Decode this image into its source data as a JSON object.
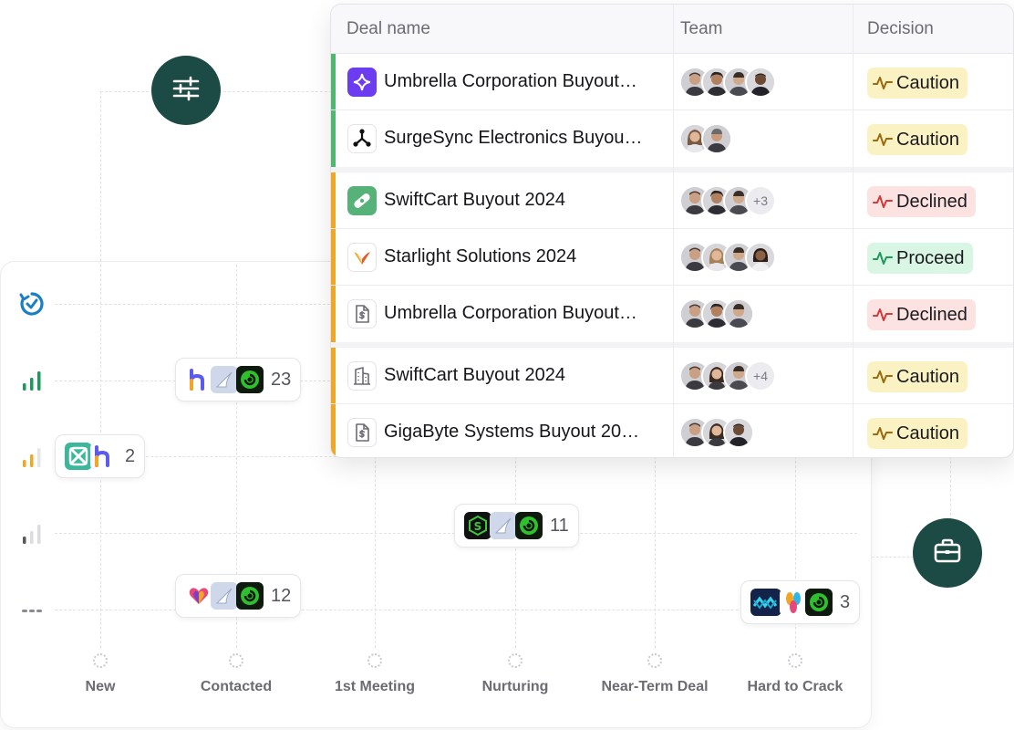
{
  "colors": {
    "accent_dark": "#1c4a44",
    "group_green": "#4cb96d",
    "group_amber": "#f2a623",
    "caution_bg": "#fbf2c4",
    "declined_bg": "#fde2e2",
    "proceed_bg": "#d9f5e3"
  },
  "table": {
    "headers": {
      "deal_name": "Deal name",
      "team": "Team",
      "decision": "Decision"
    },
    "rows": [
      {
        "name": "Umbrella Corporation Buyout…",
        "icon": "sparkle-logo-icon",
        "extra": "",
        "decision": "Caution"
      },
      {
        "name": "SurgeSync Electronics Buyou…",
        "icon": "network-logo-icon",
        "extra": "",
        "decision": "Caution"
      },
      {
        "name": "SwiftCart Buyout 2024",
        "icon": "bandage-logo-icon",
        "extra": "+3",
        "decision": "Declined"
      },
      {
        "name": "Starlight Solutions 2024",
        "icon": "wings-logo-icon",
        "extra": "",
        "decision": "Proceed"
      },
      {
        "name": "Umbrella Corporation Buyout…",
        "icon": "document-dollar-icon",
        "extra": "",
        "decision": "Declined"
      },
      {
        "name": "SwiftCart Buyout 2024",
        "icon": "building-icon",
        "extra": "+4",
        "decision": "Caution"
      },
      {
        "name": "GigaByte Systems Buyout 20…",
        "icon": "document-dollar-icon",
        "extra": "",
        "decision": "Caution"
      }
    ]
  },
  "pipeline": {
    "stages": [
      "New",
      "Contacted",
      "1st Meeting",
      "Nurturing",
      "Near-Term Deal",
      "Hard to Crack"
    ],
    "priority_icons": [
      "refresh-icon",
      "signal-high-icon",
      "signal-medium-icon",
      "signal-low-icon",
      "no-priority-icon"
    ],
    "chips": [
      {
        "count": "23",
        "logos": [
          "h-logo-icon",
          "feather-logo-icon",
          "spiral-logo-icon"
        ]
      },
      {
        "count": "2",
        "logos": [
          "frame-logo-icon",
          "h-logo-icon"
        ]
      },
      {
        "count": "11",
        "logos": [
          "s-logo-icon",
          "feather-logo-icon",
          "spiral-logo-icon"
        ]
      },
      {
        "count": "12",
        "logos": [
          "heart-logo-icon",
          "feather-logo-icon",
          "spiral-logo-icon"
        ]
      },
      {
        "count": "3",
        "logos": [
          "wave-logo-icon",
          "petal-logo-icon",
          "spiral-logo-icon"
        ]
      }
    ]
  },
  "buttons": {
    "filter": "sliders-icon",
    "portfolio": "briefcase-icon"
  }
}
